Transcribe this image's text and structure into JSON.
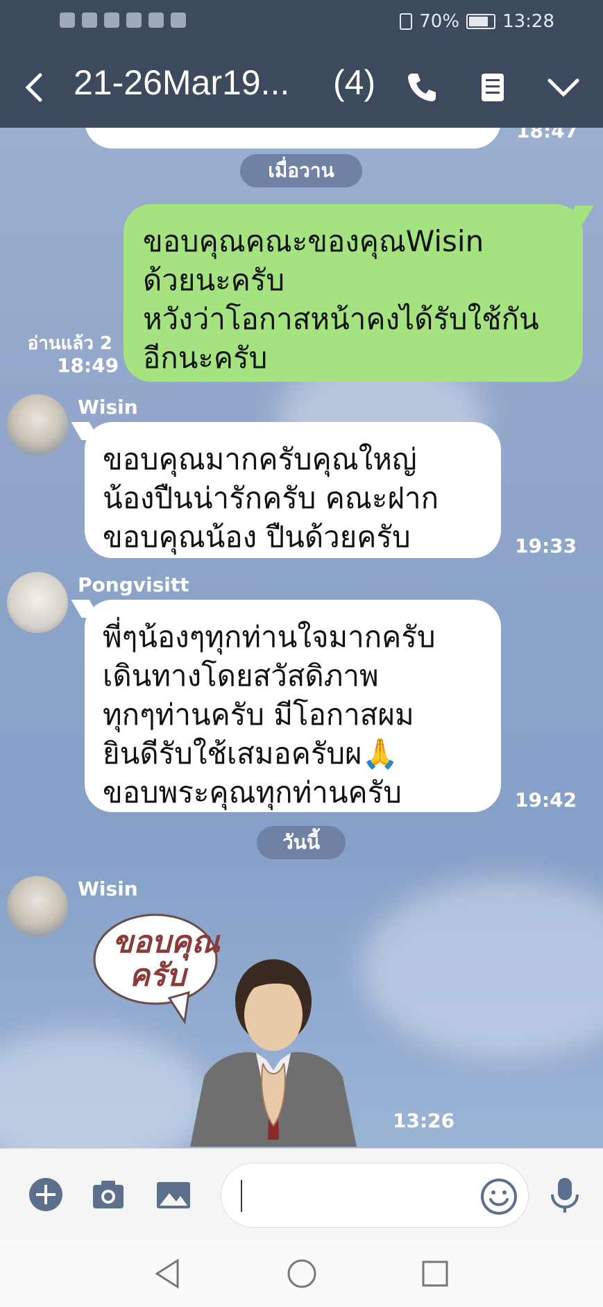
{
  "status_bar": {
    "battery": "70%",
    "time": "13:28"
  },
  "header": {
    "title": "21-26Mar19...",
    "member_count": "(4)"
  },
  "chat": {
    "date_separators": [
      "เมื่อวาน",
      "วันนี้"
    ],
    "messages": [
      {
        "type": "outgoing",
        "text": "ขอบคุณคณะของคุณWisin\nด้วยนะครับ\nหวังว่าโอกาสหน้าคงได้รับใช้กัน\nอีกนะครับ",
        "read": "อ่านแล้ว 2",
        "time": "18:49"
      },
      {
        "type": "incoming",
        "sender": "Wisin",
        "text": "ขอบคุณมากครับคุณใหญ่\nน้องปืนน่ารักครับ คณะฝาก\nขอบคุณน้อง ปืนด้วยครับ",
        "time": "19:33"
      },
      {
        "type": "incoming",
        "sender": "Pongvisitt",
        "text": "พี่ๆน้องๆทุกท่านใจมากครับ\nเดินทางโดยสวัสดิภาพ\nทุกๆท่านครับ มีโอกาสผม\nยินดีรับใช้เสมอครับผ🙏\nขอบพระคุณทุกท่านครับ",
        "time": "19:42"
      },
      {
        "type": "sticker",
        "sender": "Wisin",
        "sticker_text": "ขอบคุณ\nครับ",
        "time": "13:26"
      }
    ],
    "previous_time": "18:47"
  },
  "icons": {
    "back": "back-arrow-icon",
    "call": "phone-icon",
    "notes": "notes-icon",
    "menu": "chevron-down-icon",
    "add": "plus-icon",
    "camera": "camera-icon",
    "image": "image-icon",
    "emoji": "emoji-icon",
    "mic": "mic-icon"
  },
  "colors": {
    "header": "#3d4a5e",
    "outgoing": "#a4e37f",
    "incoming": "#ffffff",
    "pill": "#6f82a6"
  }
}
